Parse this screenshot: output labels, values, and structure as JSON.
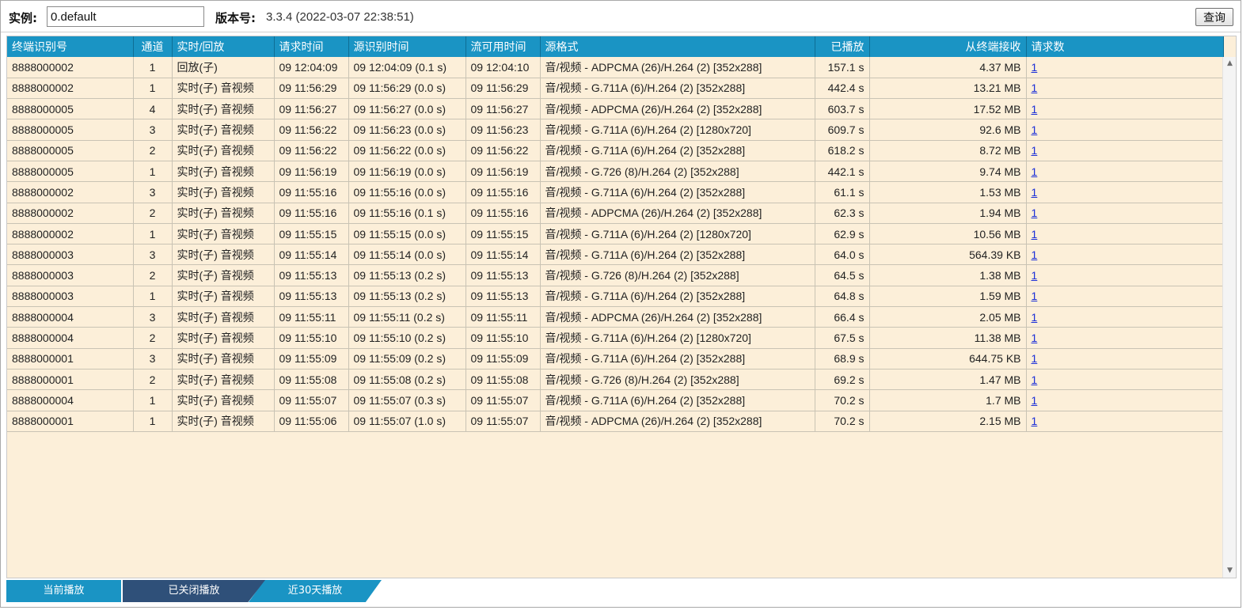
{
  "header": {
    "instance_label": "实例:",
    "instance_value": "0.default",
    "version_label": "版本号:",
    "version_value": "3.3.4 (2022-03-07 22:38:51)",
    "query_button": "查询"
  },
  "table": {
    "columns": [
      "终端识别号",
      "通道",
      "实时/回放",
      "请求时间",
      "源识别时间",
      "流可用时间",
      "源格式",
      "已播放",
      "从终端接收",
      "请求数"
    ],
    "rows": [
      [
        "8888000002",
        "1",
        "回放(子)",
        "09 12:04:09",
        "09 12:04:09 (0.1 s)",
        "09 12:04:10",
        "音/视频 - ADPCMA (26)/H.264 (2) [352x288]",
        "157.1 s",
        "4.37 MB",
        "1"
      ],
      [
        "8888000002",
        "1",
        "实时(子) 音视频",
        "09 11:56:29",
        "09 11:56:29 (0.0 s)",
        "09 11:56:29",
        "音/视频 - G.711A (6)/H.264 (2) [352x288]",
        "442.4 s",
        "13.21 MB",
        "1"
      ],
      [
        "8888000005",
        "4",
        "实时(子) 音视频",
        "09 11:56:27",
        "09 11:56:27 (0.0 s)",
        "09 11:56:27",
        "音/视频 - ADPCMA (26)/H.264 (2) [352x288]",
        "603.7 s",
        "17.52 MB",
        "1"
      ],
      [
        "8888000005",
        "3",
        "实时(子) 音视频",
        "09 11:56:22",
        "09 11:56:23 (0.0 s)",
        "09 11:56:23",
        "音/视频 - G.711A (6)/H.264 (2) [1280x720]",
        "609.7 s",
        "92.6 MB",
        "1"
      ],
      [
        "8888000005",
        "2",
        "实时(子) 音视频",
        "09 11:56:22",
        "09 11:56:22 (0.0 s)",
        "09 11:56:22",
        "音/视频 - G.711A (6)/H.264 (2) [352x288]",
        "618.2 s",
        "8.72 MB",
        "1"
      ],
      [
        "8888000005",
        "1",
        "实时(子) 音视频",
        "09 11:56:19",
        "09 11:56:19 (0.0 s)",
        "09 11:56:19",
        "音/视频 - G.726 (8)/H.264 (2) [352x288]",
        "442.1 s",
        "9.74 MB",
        "1"
      ],
      [
        "8888000002",
        "3",
        "实时(子) 音视频",
        "09 11:55:16",
        "09 11:55:16 (0.0 s)",
        "09 11:55:16",
        "音/视频 - G.711A (6)/H.264 (2) [352x288]",
        "61.1 s",
        "1.53 MB",
        "1"
      ],
      [
        "8888000002",
        "2",
        "实时(子) 音视频",
        "09 11:55:16",
        "09 11:55:16 (0.1 s)",
        "09 11:55:16",
        "音/视频 - ADPCMA (26)/H.264 (2) [352x288]",
        "62.3 s",
        "1.94 MB",
        "1"
      ],
      [
        "8888000002",
        "1",
        "实时(子) 音视频",
        "09 11:55:15",
        "09 11:55:15 (0.0 s)",
        "09 11:55:15",
        "音/视频 - G.711A (6)/H.264 (2) [1280x720]",
        "62.9 s",
        "10.56 MB",
        "1"
      ],
      [
        "8888000003",
        "3",
        "实时(子) 音视频",
        "09 11:55:14",
        "09 11:55:14 (0.0 s)",
        "09 11:55:14",
        "音/视频 - G.711A (6)/H.264 (2) [352x288]",
        "64.0 s",
        "564.39 KB",
        "1"
      ],
      [
        "8888000003",
        "2",
        "实时(子) 音视频",
        "09 11:55:13",
        "09 11:55:13 (0.2 s)",
        "09 11:55:13",
        "音/视频 - G.726 (8)/H.264 (2) [352x288]",
        "64.5 s",
        "1.38 MB",
        "1"
      ],
      [
        "8888000003",
        "1",
        "实时(子) 音视频",
        "09 11:55:13",
        "09 11:55:13 (0.2 s)",
        "09 11:55:13",
        "音/视频 - G.711A (6)/H.264 (2) [352x288]",
        "64.8 s",
        "1.59 MB",
        "1"
      ],
      [
        "8888000004",
        "3",
        "实时(子) 音视频",
        "09 11:55:11",
        "09 11:55:11 (0.2 s)",
        "09 11:55:11",
        "音/视频 - ADPCMA (26)/H.264 (2) [352x288]",
        "66.4 s",
        "2.05 MB",
        "1"
      ],
      [
        "8888000004",
        "2",
        "实时(子) 音视频",
        "09 11:55:10",
        "09 11:55:10 (0.2 s)",
        "09 11:55:10",
        "音/视频 - G.711A (6)/H.264 (2) [1280x720]",
        "67.5 s",
        "11.38 MB",
        "1"
      ],
      [
        "8888000001",
        "3",
        "实时(子) 音视频",
        "09 11:55:09",
        "09 11:55:09 (0.2 s)",
        "09 11:55:09",
        "音/视频 - G.711A (6)/H.264 (2) [352x288]",
        "68.9 s",
        "644.75 KB",
        "1"
      ],
      [
        "8888000001",
        "2",
        "实时(子) 音视频",
        "09 11:55:08",
        "09 11:55:08 (0.2 s)",
        "09 11:55:08",
        "音/视频 - G.726 (8)/H.264 (2) [352x288]",
        "69.2 s",
        "1.47 MB",
        "1"
      ],
      [
        "8888000004",
        "1",
        "实时(子) 音视频",
        "09 11:55:07",
        "09 11:55:07 (0.3 s)",
        "09 11:55:07",
        "音/视频 - G.711A (6)/H.264 (2) [352x288]",
        "70.2 s",
        "1.7 MB",
        "1"
      ],
      [
        "8888000001",
        "1",
        "实时(子) 音视频",
        "09 11:55:06",
        "09 11:55:07 (1.0 s)",
        "09 11:55:07",
        "音/视频 - ADPCMA (26)/H.264 (2) [352x288]",
        "70.2 s",
        "2.15 MB",
        "1"
      ]
    ]
  },
  "tabs": [
    {
      "label": "当前播放",
      "active": false
    },
    {
      "label": "已关闭播放",
      "active": true
    },
    {
      "label": "近30天播放",
      "active": false
    }
  ],
  "colors": {
    "header_blue": "#1a94c4",
    "active_tab": "#2f5079",
    "row_background": "#fcefd9",
    "link": "#1a2ed8"
  },
  "icons": {
    "scroll_up": "scroll-up-arrow-icon",
    "scroll_down": "scroll-down-arrow-icon"
  }
}
